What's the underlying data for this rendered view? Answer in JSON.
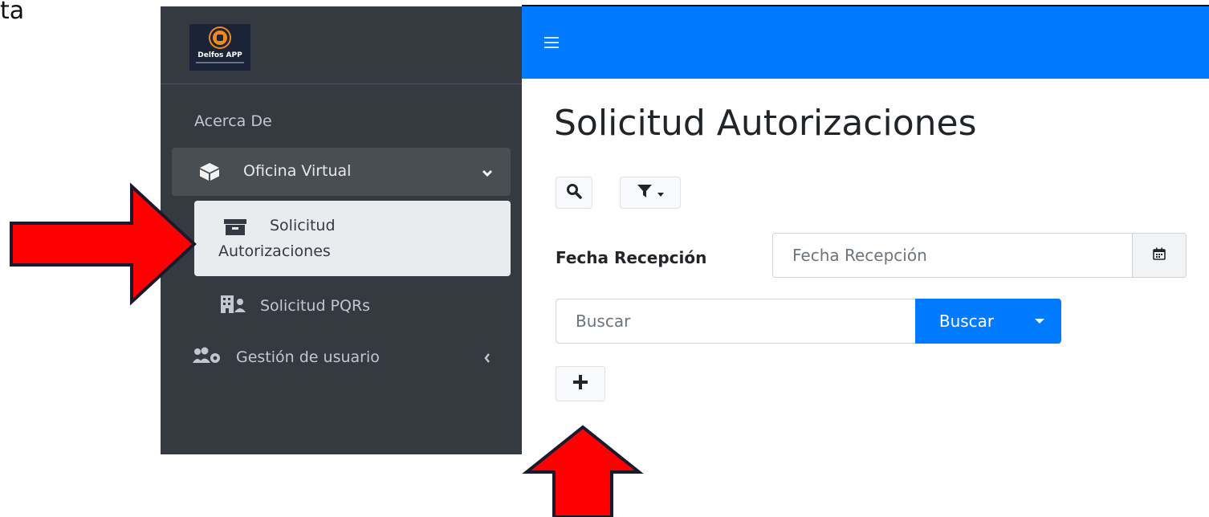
{
  "corner_fragment": "ta",
  "sidebar": {
    "logo_text": "Delfos APP",
    "header": "Acerca De",
    "open_group": "Oficina Virtual",
    "active_item_line1": "Solicitud",
    "active_item_line2": "Autorizaciones",
    "item_pqr": "Solicitud PQRs",
    "item_users": "Gestión de usuario"
  },
  "main": {
    "title": "Solicitud Autorizaciones",
    "date_label": "Fecha Recepción",
    "date_placeholder": "Fecha Recepción",
    "search_placeholder": "Buscar",
    "search_button": "Buscar"
  },
  "colors": {
    "topbar": "#007bff",
    "sidebar": "#343a40",
    "annotation_arrow": "#ff0000"
  },
  "icons": [
    "menu-icon",
    "search-icon",
    "filter-icon",
    "calendar-icon",
    "plus-icon",
    "cube-icon",
    "archive-icon",
    "building-user-icon",
    "users-cog-icon",
    "chevron-down-icon",
    "chevron-left-icon"
  ]
}
